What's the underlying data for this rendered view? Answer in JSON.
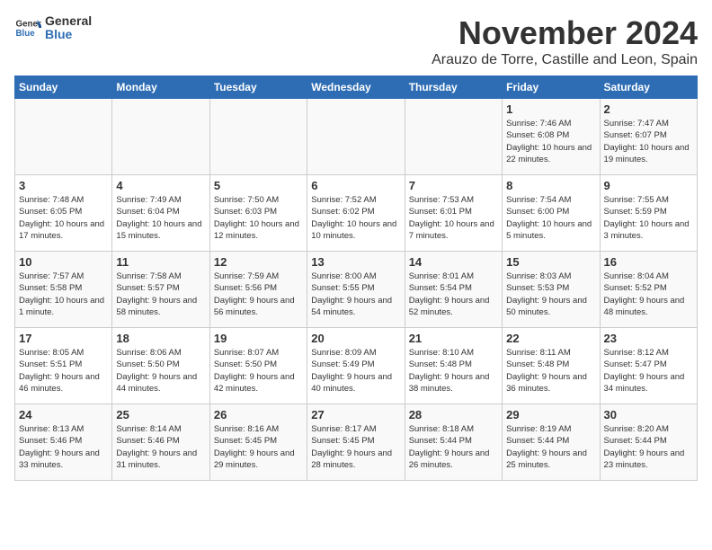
{
  "logo": {
    "general": "General",
    "blue": "Blue"
  },
  "title": "November 2024",
  "location": "Arauzo de Torre, Castille and Leon, Spain",
  "weekdays": [
    "Sunday",
    "Monday",
    "Tuesday",
    "Wednesday",
    "Thursday",
    "Friday",
    "Saturday"
  ],
  "weeks": [
    [
      {
        "day": "",
        "info": ""
      },
      {
        "day": "",
        "info": ""
      },
      {
        "day": "",
        "info": ""
      },
      {
        "day": "",
        "info": ""
      },
      {
        "day": "",
        "info": ""
      },
      {
        "day": "1",
        "info": "Sunrise: 7:46 AM\nSunset: 6:08 PM\nDaylight: 10 hours and 22 minutes."
      },
      {
        "day": "2",
        "info": "Sunrise: 7:47 AM\nSunset: 6:07 PM\nDaylight: 10 hours and 19 minutes."
      }
    ],
    [
      {
        "day": "3",
        "info": "Sunrise: 7:48 AM\nSunset: 6:05 PM\nDaylight: 10 hours and 17 minutes."
      },
      {
        "day": "4",
        "info": "Sunrise: 7:49 AM\nSunset: 6:04 PM\nDaylight: 10 hours and 15 minutes."
      },
      {
        "day": "5",
        "info": "Sunrise: 7:50 AM\nSunset: 6:03 PM\nDaylight: 10 hours and 12 minutes."
      },
      {
        "day": "6",
        "info": "Sunrise: 7:52 AM\nSunset: 6:02 PM\nDaylight: 10 hours and 10 minutes."
      },
      {
        "day": "7",
        "info": "Sunrise: 7:53 AM\nSunset: 6:01 PM\nDaylight: 10 hours and 7 minutes."
      },
      {
        "day": "8",
        "info": "Sunrise: 7:54 AM\nSunset: 6:00 PM\nDaylight: 10 hours and 5 minutes."
      },
      {
        "day": "9",
        "info": "Sunrise: 7:55 AM\nSunset: 5:59 PM\nDaylight: 10 hours and 3 minutes."
      }
    ],
    [
      {
        "day": "10",
        "info": "Sunrise: 7:57 AM\nSunset: 5:58 PM\nDaylight: 10 hours and 1 minute."
      },
      {
        "day": "11",
        "info": "Sunrise: 7:58 AM\nSunset: 5:57 PM\nDaylight: 9 hours and 58 minutes."
      },
      {
        "day": "12",
        "info": "Sunrise: 7:59 AM\nSunset: 5:56 PM\nDaylight: 9 hours and 56 minutes."
      },
      {
        "day": "13",
        "info": "Sunrise: 8:00 AM\nSunset: 5:55 PM\nDaylight: 9 hours and 54 minutes."
      },
      {
        "day": "14",
        "info": "Sunrise: 8:01 AM\nSunset: 5:54 PM\nDaylight: 9 hours and 52 minutes."
      },
      {
        "day": "15",
        "info": "Sunrise: 8:03 AM\nSunset: 5:53 PM\nDaylight: 9 hours and 50 minutes."
      },
      {
        "day": "16",
        "info": "Sunrise: 8:04 AM\nSunset: 5:52 PM\nDaylight: 9 hours and 48 minutes."
      }
    ],
    [
      {
        "day": "17",
        "info": "Sunrise: 8:05 AM\nSunset: 5:51 PM\nDaylight: 9 hours and 46 minutes."
      },
      {
        "day": "18",
        "info": "Sunrise: 8:06 AM\nSunset: 5:50 PM\nDaylight: 9 hours and 44 minutes."
      },
      {
        "day": "19",
        "info": "Sunrise: 8:07 AM\nSunset: 5:50 PM\nDaylight: 9 hours and 42 minutes."
      },
      {
        "day": "20",
        "info": "Sunrise: 8:09 AM\nSunset: 5:49 PM\nDaylight: 9 hours and 40 minutes."
      },
      {
        "day": "21",
        "info": "Sunrise: 8:10 AM\nSunset: 5:48 PM\nDaylight: 9 hours and 38 minutes."
      },
      {
        "day": "22",
        "info": "Sunrise: 8:11 AM\nSunset: 5:48 PM\nDaylight: 9 hours and 36 minutes."
      },
      {
        "day": "23",
        "info": "Sunrise: 8:12 AM\nSunset: 5:47 PM\nDaylight: 9 hours and 34 minutes."
      }
    ],
    [
      {
        "day": "24",
        "info": "Sunrise: 8:13 AM\nSunset: 5:46 PM\nDaylight: 9 hours and 33 minutes."
      },
      {
        "day": "25",
        "info": "Sunrise: 8:14 AM\nSunset: 5:46 PM\nDaylight: 9 hours and 31 minutes."
      },
      {
        "day": "26",
        "info": "Sunrise: 8:16 AM\nSunset: 5:45 PM\nDaylight: 9 hours and 29 minutes."
      },
      {
        "day": "27",
        "info": "Sunrise: 8:17 AM\nSunset: 5:45 PM\nDaylight: 9 hours and 28 minutes."
      },
      {
        "day": "28",
        "info": "Sunrise: 8:18 AM\nSunset: 5:44 PM\nDaylight: 9 hours and 26 minutes."
      },
      {
        "day": "29",
        "info": "Sunrise: 8:19 AM\nSunset: 5:44 PM\nDaylight: 9 hours and 25 minutes."
      },
      {
        "day": "30",
        "info": "Sunrise: 8:20 AM\nSunset: 5:44 PM\nDaylight: 9 hours and 23 minutes."
      }
    ]
  ]
}
